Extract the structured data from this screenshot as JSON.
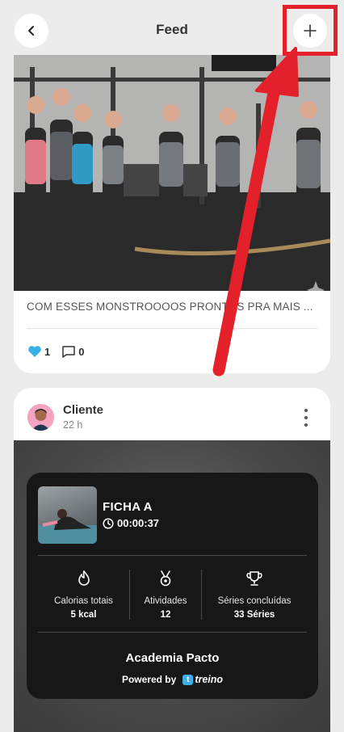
{
  "header": {
    "title": "Feed"
  },
  "post1": {
    "caption": "COM ESSES MONSTROOOOS PRONTOS PRA MAIS ...",
    "likes": "1",
    "comments": "0"
  },
  "post2": {
    "author": "Cliente",
    "time": "22 h",
    "workout": {
      "name": "FICHA A",
      "duration": "00:00:37",
      "stats": [
        {
          "label": "Calorias totais",
          "value": "5 kcal",
          "icon": "flame-icon"
        },
        {
          "label": "Atividades",
          "value": "12",
          "icon": "medal-icon"
        },
        {
          "label": "Séries concluídas",
          "value": "33 Séries",
          "icon": "trophy-icon"
        }
      ],
      "gym": "Academia Pacto",
      "powered_by": "Powered by",
      "brand": "treino"
    }
  },
  "colors": {
    "accent_like": "#3ab0e8",
    "annotation": "#e4202a"
  }
}
